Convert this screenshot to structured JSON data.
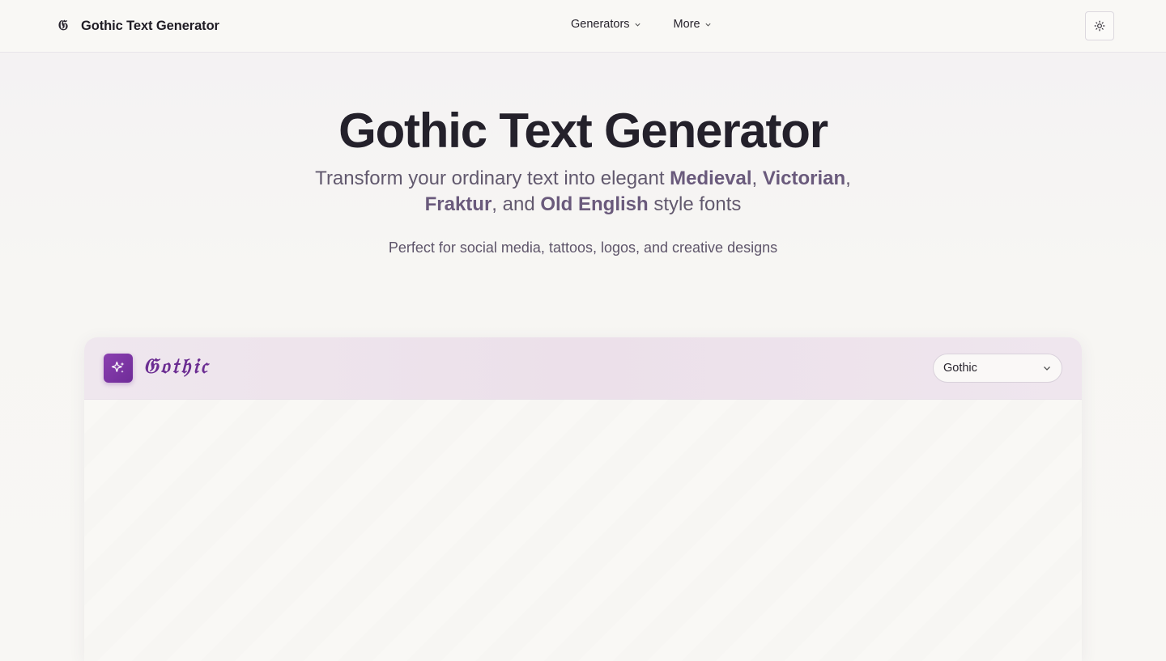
{
  "navbar": {
    "logo_glyph": "𝔊",
    "brand_name": "Gothic Text Generator",
    "menu": [
      {
        "label": "Generators"
      },
      {
        "label": "More"
      }
    ],
    "theme_toggle_icon": "sun-icon"
  },
  "hero": {
    "title": "Gothic Text Generator",
    "subtitle_parts": {
      "p1": "Transform your ordinary text into elegant ",
      "b1": "Medieval",
      "p2": ", ",
      "b2": "Victorian",
      "p3": ", ",
      "b3": "Fraktur",
      "p4": ", and ",
      "b4": "Old English",
      "p5": " style fonts"
    },
    "tagline": "Perfect for social media, tattoos, logos, and creative designs"
  },
  "generator": {
    "icon": "sparkles-icon",
    "title": "𝔊𝔬𝔱𝔥𝔦𝔠",
    "style_select": {
      "value": "Gothic"
    }
  },
  "colors": {
    "accent": "#7a35a3",
    "text": "#24212b",
    "muted": "#62596e"
  }
}
